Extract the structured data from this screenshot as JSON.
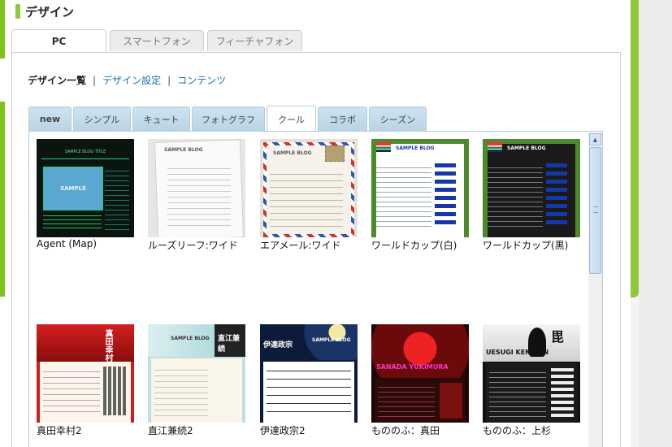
{
  "page": {
    "title": "デザイン"
  },
  "device_tabs": [
    {
      "label": "PC",
      "active": true
    },
    {
      "label": "スマートフォン",
      "active": false
    },
    {
      "label": "フィーチャフォン",
      "active": false
    }
  ],
  "subnav": {
    "current": "デザイン一覧",
    "links": [
      "デザイン設定",
      "コンテンツ"
    ],
    "separator": "|"
  },
  "category_tabs": [
    {
      "label": "new",
      "active": false
    },
    {
      "label": "シンプル",
      "active": false
    },
    {
      "label": "キュート",
      "active": false
    },
    {
      "label": "フォトグラフ",
      "active": false
    },
    {
      "label": "クール",
      "active": true
    },
    {
      "label": "コラボ",
      "active": false
    },
    {
      "label": "シーズン",
      "active": false
    }
  ],
  "designs": [
    {
      "name": "Agent (Map)",
      "thumb_text": "SAMPLE",
      "header_text": "SAMPLE BLOG TITLE"
    },
    {
      "name": "ルーズリーフ:ワイド",
      "thumb_text": "SAMPLE BLOG"
    },
    {
      "name": "エアメール:ワイド",
      "thumb_text": "SAMPLE BLOG"
    },
    {
      "name": "ワールドカップ(白)",
      "thumb_text": "SAMPLE BLOG"
    },
    {
      "name": "ワールドカップ(黒)",
      "thumb_text": "SAMPLE BLOG"
    },
    {
      "name": "真田幸村2",
      "thumb_text": "真田幸村"
    },
    {
      "name": "直江兼続2",
      "thumb_text": "SAMPLE BLOG",
      "header_text": "直江兼続"
    },
    {
      "name": "伊達政宗2",
      "thumb_text": "SAMPLE BLOG",
      "header_text": "伊達政宗"
    },
    {
      "name": "もののふ：真田",
      "thumb_text": "SANADA YUKIMURA"
    },
    {
      "name": "もののふ：上杉",
      "thumb_text": "UESUGI KENSHIN",
      "header_text": "毘"
    }
  ],
  "colors": {
    "accent_green": "#8fc83a",
    "link_blue": "#1a6fb0",
    "tab_blue": "#cfe3ef"
  },
  "icons": {
    "scroll_up": "▲"
  }
}
